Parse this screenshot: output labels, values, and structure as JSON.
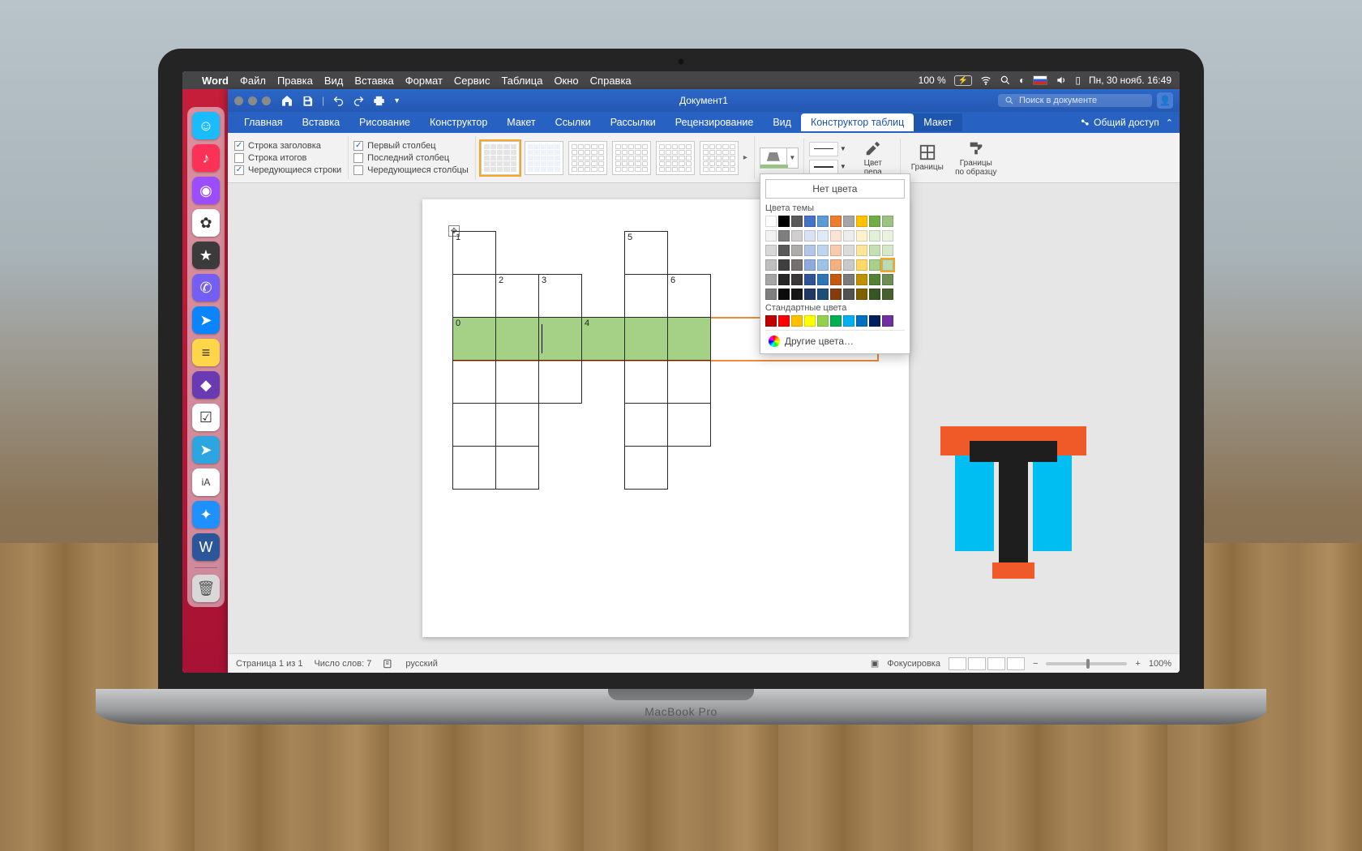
{
  "mac": {
    "app": "Word",
    "menus": [
      "Файл",
      "Правка",
      "Вид",
      "Вставка",
      "Формат",
      "Сервис",
      "Таблица",
      "Окно",
      "Справка"
    ],
    "battery": "100 %",
    "datetime": "Пн, 30 нояб.  16:49",
    "laptop_model": "MacBook Pro"
  },
  "word": {
    "doc_title": "Документ1",
    "search_placeholder": "Поиск в документе",
    "share": "Общий доступ",
    "tabs": [
      "Главная",
      "Вставка",
      "Рисование",
      "Конструктор",
      "Макет",
      "Ссылки",
      "Рассылки",
      "Рецензирование",
      "Вид"
    ],
    "context_tabs": [
      "Конструктор таблиц",
      "Макет"
    ],
    "active_tab": "Конструктор таблиц",
    "options": {
      "header_row": "Строка заголовка",
      "total_row": "Строка итогов",
      "banded_rows": "Чередующиеся строки",
      "first_col": "Первый столбец",
      "last_col": "Последний столбец",
      "banded_cols": "Чередующиеся столбцы"
    },
    "buttons": {
      "pen_color": "Цвет\nпера",
      "borders": "Границы",
      "border_painter": "Границы\nпо образцу"
    },
    "color_popup": {
      "no_color": "Нет цвета",
      "theme": "Цвета темы",
      "standard": "Стандартные цвета",
      "more": "Другие цвета…"
    }
  },
  "crossword": {
    "numbers": {
      "c_0_0": "1",
      "c_0_4": "5",
      "c_1_1": "2",
      "c_1_2": "3",
      "c_1_5": "6",
      "c_2_0": "0",
      "c_2_3": "4"
    },
    "rows": 6,
    "cols": 6,
    "highlight_row": 2
  },
  "status": {
    "page": "Страница 1 из 1",
    "words": "Число слов: 7",
    "lang": "русский",
    "focus": "Фокусировка",
    "zoom": "100%"
  },
  "dock_items": [
    {
      "name": "finder",
      "bg": "#1abcfe",
      "glyph": "☺"
    },
    {
      "name": "music",
      "bg": "#fc3158",
      "glyph": "♪"
    },
    {
      "name": "podcasts",
      "bg": "#9b4dff",
      "glyph": "◉"
    },
    {
      "name": "photos",
      "bg": "#ffffff",
      "glyph": "✿"
    },
    {
      "name": "favorites",
      "bg": "#3b3b3b",
      "glyph": "★"
    },
    {
      "name": "viber",
      "bg": "#7360f2",
      "glyph": "✆"
    },
    {
      "name": "maps",
      "bg": "#0a84ff",
      "glyph": "➤"
    },
    {
      "name": "notes",
      "bg": "#ffd54a",
      "glyph": "≡"
    },
    {
      "name": "affinity",
      "bg": "#6a3ab2",
      "glyph": "◆"
    },
    {
      "name": "things",
      "bg": "#ffffff",
      "glyph": "☑"
    },
    {
      "name": "telegram",
      "bg": "#2ca5e0",
      "glyph": "➤"
    },
    {
      "name": "ia-writer",
      "bg": "#ffffff",
      "glyph": "iA"
    },
    {
      "name": "safari",
      "bg": "#1e90ff",
      "glyph": "✦"
    },
    {
      "name": "word",
      "bg": "#2b579a",
      "glyph": "W"
    }
  ],
  "theme_row": [
    "#ffffff",
    "#000000",
    "#595959",
    "#4472c4",
    "#5b9bd5",
    "#ed7d31",
    "#a5a5a5",
    "#ffc000",
    "#70ad47",
    "#9dc284"
  ],
  "theme_tints": [
    [
      "#f2f2f2",
      "#7f7f7f",
      "#d0cece",
      "#d9e2f3",
      "#deeaf6",
      "#fbe4d5",
      "#ededed",
      "#fff2cc",
      "#e2efd9",
      "#eaf3e2"
    ],
    [
      "#d8d8d8",
      "#595959",
      "#aeabab",
      "#b4c6e7",
      "#bdd6ee",
      "#f7cbac",
      "#dbdbdb",
      "#fee599",
      "#c5e0b3",
      "#d5e8c8"
    ],
    [
      "#bfbfbf",
      "#3f3f3f",
      "#757070",
      "#8eaadb",
      "#9cc2e5",
      "#f4b083",
      "#c9c9c9",
      "#ffd965",
      "#a8d08d",
      "#bedaae"
    ],
    [
      "#a5a5a5",
      "#262626",
      "#3a3838",
      "#2f5496",
      "#2e75b5",
      "#c45911",
      "#7b7b7b",
      "#bf9000",
      "#538135",
      "#6d8f53"
    ],
    [
      "#7f7f7f",
      "#0c0c0c",
      "#171616",
      "#1f3864",
      "#1e4e79",
      "#833c0b",
      "#525252",
      "#7f6000",
      "#375623",
      "#49602f"
    ]
  ],
  "standard_colors": [
    "#c00000",
    "#ff0000",
    "#ffc000",
    "#ffff00",
    "#92d050",
    "#00b050",
    "#00b0f0",
    "#0070c0",
    "#002060",
    "#7030a0"
  ]
}
